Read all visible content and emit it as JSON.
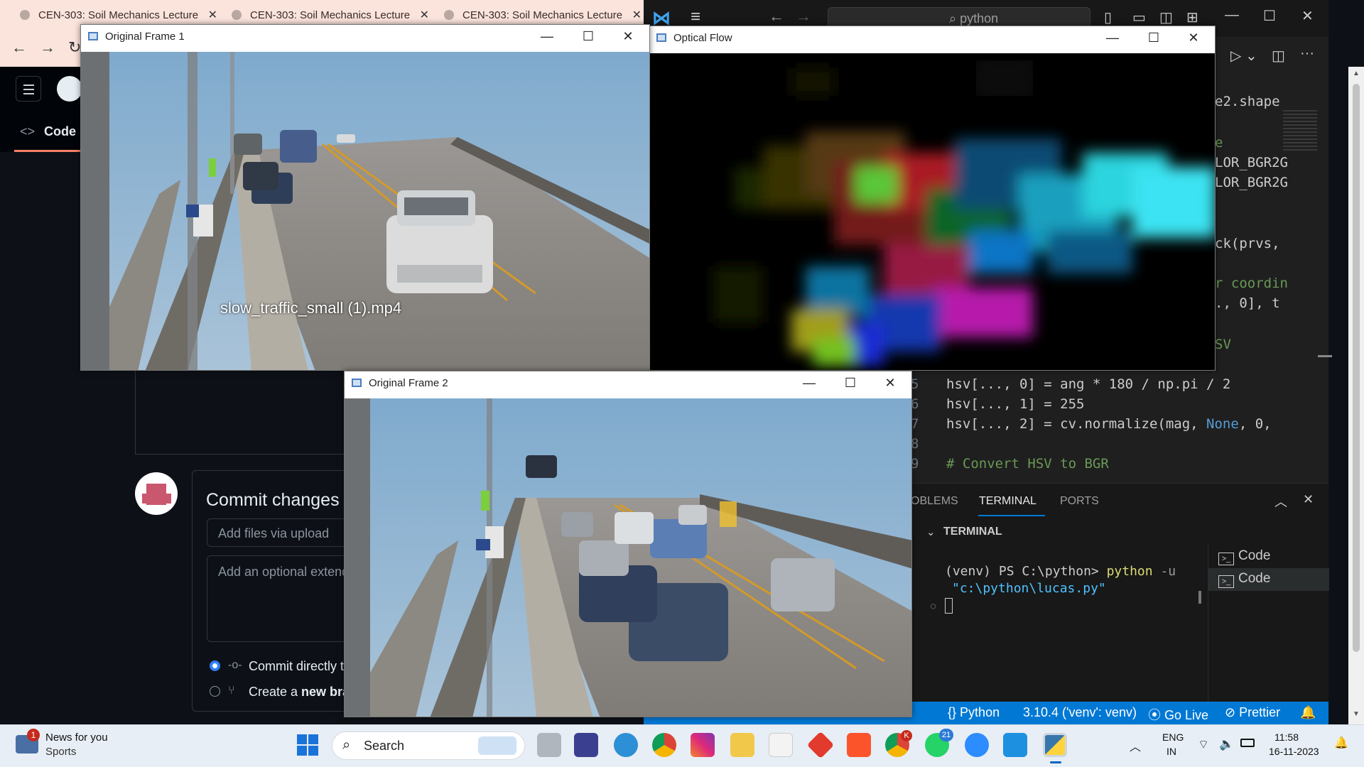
{
  "browser": {
    "tabs": [
      {
        "label": "CEN-303: Soil Mechanics Lecture"
      },
      {
        "label": "CEN-303: Soil Mechanics Lecture"
      },
      {
        "label": "CEN-303: Soil Mechanics Lecture"
      }
    ],
    "github": {
      "code_tab": "Code",
      "commit_title": "Commit changes",
      "commit_input_placeholder": "Add files via upload",
      "commit_desc_placeholder": "Add an optional extended",
      "radio_commit_direct": "Commit directly t",
      "radio_new_branch_prefix": "Create a ",
      "radio_new_branch_bold": "new bra"
    }
  },
  "windows": {
    "frame1": {
      "title": "Original Frame 1",
      "caption": "slow_traffic_small (1).mp4"
    },
    "optical_flow": {
      "title": "Optical Flow"
    },
    "frame2": {
      "title": "Original Frame 2"
    }
  },
  "vscode": {
    "search": "python",
    "code_fragments": {
      "l1": "e2.shape",
      "l2": "e",
      "l3": "LOR_BGR2G",
      "l4": "LOR_BGR2G",
      "l5": "ck(prvs,",
      "l6": "r coordin",
      "l7": "., 0], t",
      "l8": "SV"
    },
    "lines": [
      {
        "n": "5",
        "code_a": "hsv[..., 0] = ang * 180 / np.pi / 2"
      },
      {
        "n": "6",
        "code_a": "hsv[..., 1] = 255"
      },
      {
        "n": "7",
        "code_a": "hsv[..., 2] = cv.normalize(mag, ",
        "code_b": "None",
        "code_c": ", 0,"
      },
      {
        "n": "8",
        "code_a": ""
      },
      {
        "n": "9",
        "comment": "# Convert HSV to BGR"
      }
    ],
    "panel_tabs": [
      "OBLEMS",
      "TERMINAL",
      "PORTS"
    ],
    "terminal_header": "TERMINAL",
    "terminal": {
      "prompt": "(venv) PS C:\\python> ",
      "cmd": "python",
      "flag": " -u",
      "path": "\"c:\\python\\lucas.py\""
    },
    "terminal_list": [
      "Code",
      "Code"
    ],
    "status": {
      "lang": "Python",
      "interpreter": "3.10.4 ('venv': venv)",
      "golive": "Go Live",
      "prettier": "Prettier"
    }
  },
  "taskbar": {
    "news_title": "News for you",
    "news_sub": "Sports",
    "news_badge": "1",
    "search": "Search",
    "whatsapp_badge": "21",
    "chrome_badge": "K",
    "lang_top": "ENG",
    "lang_bottom": "IN",
    "time": "11:58",
    "date": "16-11-2023"
  },
  "colors": {
    "vscode_accent": "#0078d4",
    "github_bg": "#0d1117",
    "tab_bg": "#fbe4dc",
    "keyword": "#569cd6",
    "comment": "#6a9955",
    "number": "#b5cea8",
    "terminal_cmd": "#dcdc75",
    "terminal_path": "#4fc1ff"
  }
}
